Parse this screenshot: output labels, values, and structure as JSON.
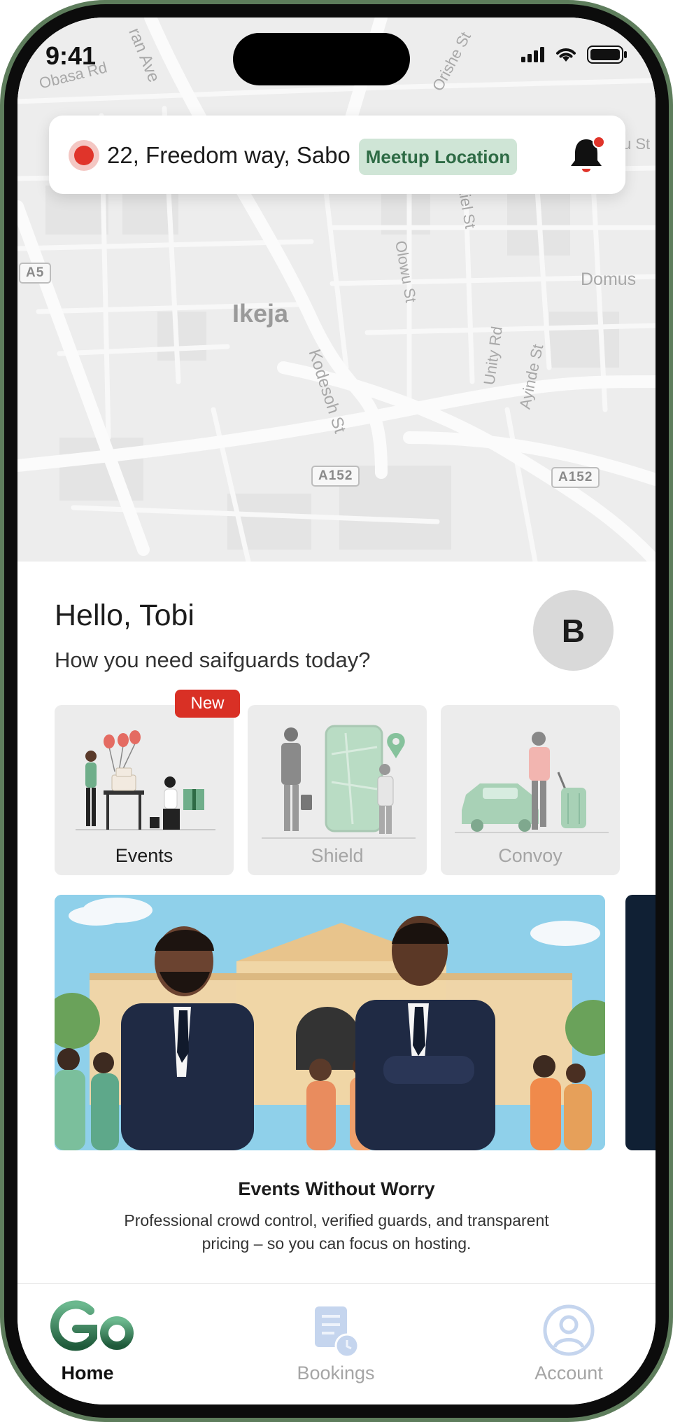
{
  "status_bar": {
    "time": "9:41"
  },
  "map": {
    "area_label": "Ikeja",
    "streets": [
      "Obasa Rd",
      "ran Ave",
      "Orishe St",
      "Ezekiel St",
      "Olowu St",
      "Kodesoh St",
      "Unity Rd",
      "Ayinde St",
      "Domus",
      "u St"
    ],
    "road_shields": [
      "A5",
      "A152",
      "A152"
    ]
  },
  "location_card": {
    "address": "22, Freedom way, Sabo",
    "badge": "Meetup Location",
    "bell_icon": "bell-icon",
    "accent_color": "#e0342a"
  },
  "greeting": {
    "hello": "Hello, Tobi",
    "question": "How you need saifguards today?",
    "avatar_initial": "B"
  },
  "services": {
    "new_badge": "New",
    "items": [
      {
        "label": "Events",
        "active": true
      },
      {
        "label": "Shield",
        "active": false
      },
      {
        "label": "Convoy",
        "active": false
      }
    ]
  },
  "banner": {
    "title": "Events Without Worry",
    "description": "Professional crowd control, verified guards, and transparent pricing – so you can focus on hosting."
  },
  "bottom_nav": {
    "logo_text": "Go",
    "items": [
      {
        "label": "Home",
        "icon": "go-logo-icon",
        "active": true
      },
      {
        "label": "Bookings",
        "icon": "bookings-icon",
        "active": false
      },
      {
        "label": "Account",
        "icon": "account-icon",
        "active": false
      }
    ]
  },
  "colors": {
    "brand_green": "#2e6b45",
    "badge_bg": "#cfe5d6",
    "new_red": "#d93025"
  }
}
